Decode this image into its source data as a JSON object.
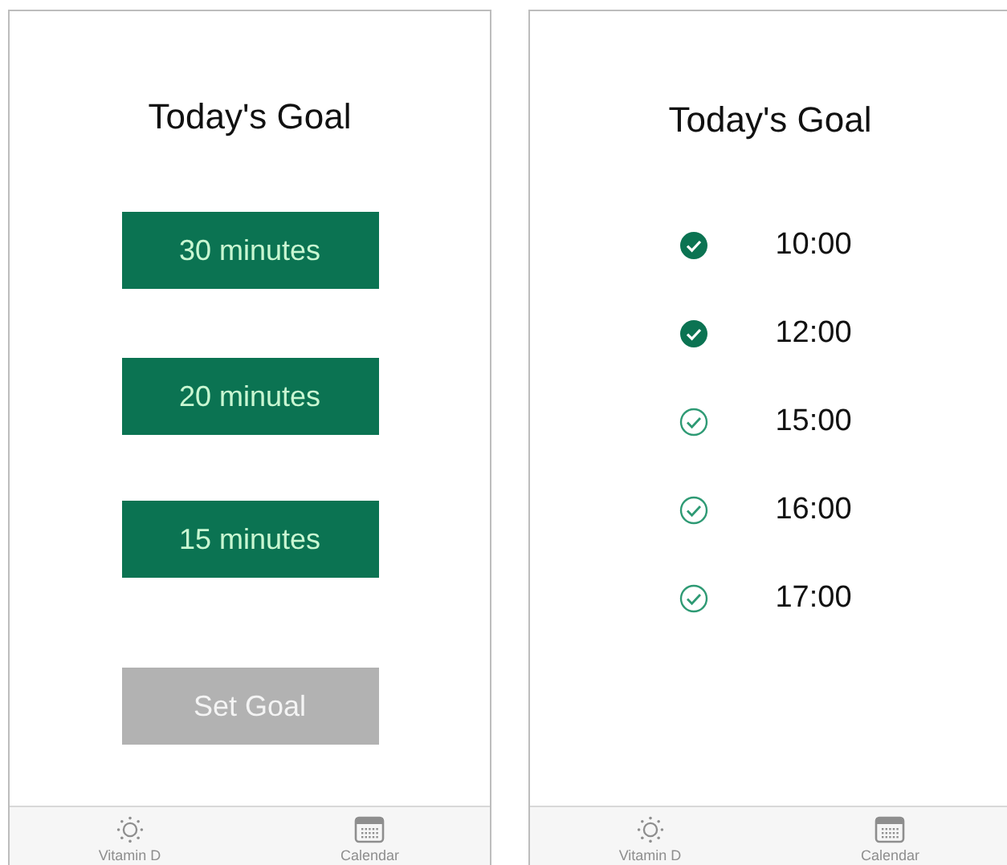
{
  "screens": [
    {
      "kind": "goal",
      "title": "Today's Goal",
      "options": [
        {
          "label": "30 minutes"
        },
        {
          "label": "20 minutes"
        },
        {
          "label": "15 minutes"
        }
      ],
      "action": {
        "label": "Set Goal",
        "disabled": true
      },
      "tab_bar": [
        {
          "kind": "sun",
          "label": "Vitamin D",
          "selected": false
        },
        {
          "kind": "calendar",
          "label": "Calendar",
          "selected": false
        }
      ]
    },
    {
      "kind": "schedule",
      "title": "Today's Goal",
      "times": [
        {
          "time": "10:00",
          "checked": true
        },
        {
          "time": "12:00",
          "checked": true
        },
        {
          "time": "15:00",
          "checked": false
        },
        {
          "time": "16:00",
          "checked": false
        },
        {
          "time": "17:00",
          "checked": false
        }
      ],
      "tab_bar": [
        {
          "kind": "sun",
          "label": "Vitamin D",
          "selected": false
        },
        {
          "kind": "calendar",
          "label": "Calendar",
          "selected": false
        }
      ]
    }
  ]
}
